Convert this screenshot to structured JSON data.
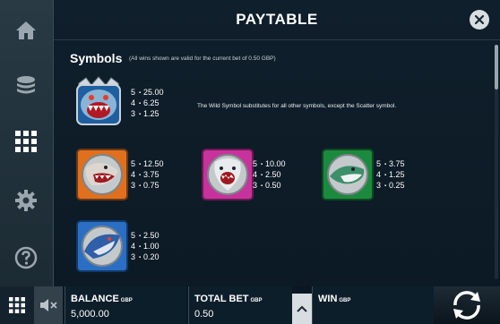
{
  "header": {
    "title": "PAYTABLE"
  },
  "symbols_section": {
    "title": "Symbols",
    "note": "(All wins shown are valid for the current bet of 0.50 GBP)",
    "wild_description": "The Wild Symbol substitutes for all other symbols, except the Scatter symbol.",
    "items": [
      {
        "name": "wild-shark",
        "pays": [
          {
            "count": "5",
            "value": "25.00"
          },
          {
            "count": "4",
            "value": "6.25"
          },
          {
            "count": "3",
            "value": "1.25"
          }
        ]
      },
      {
        "name": "orange-shark",
        "pays": [
          {
            "count": "5",
            "value": "12.50"
          },
          {
            "count": "4",
            "value": "3.75"
          },
          {
            "count": "3",
            "value": "0.75"
          }
        ]
      },
      {
        "name": "pink-shark",
        "pays": [
          {
            "count": "5",
            "value": "10.00"
          },
          {
            "count": "4",
            "value": "2.50"
          },
          {
            "count": "3",
            "value": "0.50"
          }
        ]
      },
      {
        "name": "green-shark",
        "pays": [
          {
            "count": "5",
            "value": "3.75"
          },
          {
            "count": "4",
            "value": "1.25"
          },
          {
            "count": "3",
            "value": "0.25"
          }
        ]
      },
      {
        "name": "blue-shark",
        "pays": [
          {
            "count": "5",
            "value": "2.50"
          },
          {
            "count": "4",
            "value": "1.00"
          },
          {
            "count": "3",
            "value": "0.20"
          }
        ]
      }
    ]
  },
  "footer": {
    "balance_label": "BALANCE",
    "balance_currency": "GBP",
    "balance_value": "5,000.00",
    "bet_label": "TOTAL BET",
    "bet_currency": "GBP",
    "bet_value": "0.50",
    "win_label": "WIN",
    "win_currency": "GBP"
  },
  "icons": {
    "rail": [
      "home-icon",
      "coins-icon",
      "paytable-grid-icon",
      "settings-gear-icon",
      "help-icon"
    ],
    "bottom": [
      "menu-grid-icon",
      "sound-muted-icon",
      "chevron-up-icon",
      "spin-icon"
    ]
  },
  "colors": {
    "accent": "#ff5a45",
    "panel": "#0f1f2b",
    "text": "#ffffff"
  }
}
